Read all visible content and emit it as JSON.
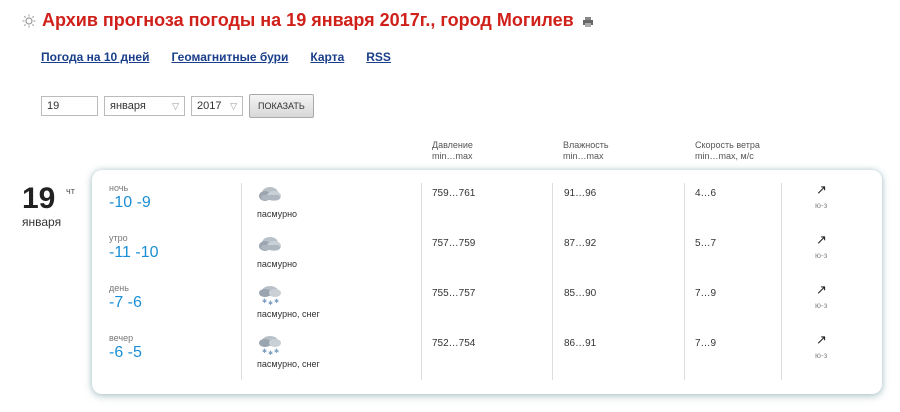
{
  "header": {
    "title": "Архив прогноза погоды на 19 января 2017г., город Могилев"
  },
  "nav": [
    {
      "label": "Погода на 10 дней"
    },
    {
      "label": "Геомагнитные бури"
    },
    {
      "label": "Карта"
    },
    {
      "label": "RSS"
    }
  ],
  "form": {
    "day_value": "19",
    "month_value": "января",
    "year_value": "2017",
    "submit_label": "ПОКАЗАТЬ"
  },
  "columns": {
    "pressure": {
      "label": "Давление",
      "sub": "min…max"
    },
    "humidity": {
      "label": "Влажность",
      "sub": "min…max"
    },
    "wind": {
      "label": "Скорость ветра",
      "sub": "min…max, м/с"
    }
  },
  "date": {
    "day": "19",
    "weekday": "чт",
    "month": "января"
  },
  "rows": [
    {
      "part": "ночь",
      "temp": "-10 -9",
      "cond": "пасмурно",
      "icon": "cloudy-icon",
      "pressure": "759…761",
      "humidity": "91…96",
      "wind": "4…6",
      "wind_arrow": "↗",
      "wind_dir": "ю-з"
    },
    {
      "part": "утро",
      "temp": "-11 -10",
      "cond": "пасмурно",
      "icon": "cloudy-icon",
      "pressure": "757…759",
      "humidity": "87…92",
      "wind": "5…7",
      "wind_arrow": "↗",
      "wind_dir": "ю-з"
    },
    {
      "part": "день",
      "temp": "-7 -6",
      "cond": "пасмурно, снег",
      "icon": "snow-cloud-icon",
      "pressure": "755…757",
      "humidity": "85…90",
      "wind": "7…9",
      "wind_arrow": "↗",
      "wind_dir": "ю-з"
    },
    {
      "part": "вечер",
      "temp": "-6 -5",
      "cond": "пасмурно, снег",
      "icon": "snow-cloud-icon",
      "pressure": "752…754",
      "humidity": "86…91",
      "wind": "7…9",
      "wind_arrow": "↗",
      "wind_dir": "ю-з"
    }
  ]
}
